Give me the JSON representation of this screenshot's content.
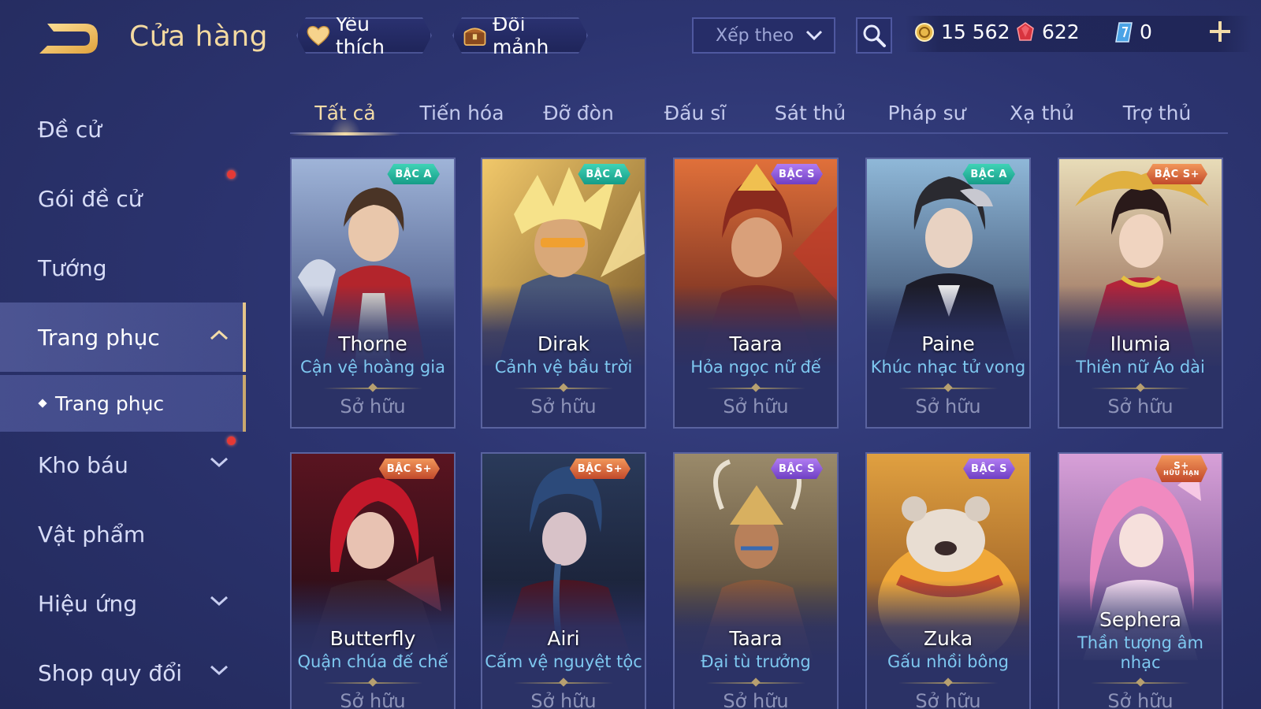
{
  "header": {
    "title": "Cửa hàng",
    "favorite_label": "Yêu thích",
    "fragment_label": "Đổi mảnh",
    "sort_label": "Xếp theo",
    "currency": {
      "gold": "15 562",
      "ruby": "622",
      "voucher": "0"
    }
  },
  "sidebar": {
    "items": [
      {
        "label": "Đề cử"
      },
      {
        "label": "Gói đề cử"
      },
      {
        "label": "Tướng"
      },
      {
        "label": "Trang phục"
      },
      {
        "label": "Kho báu"
      },
      {
        "label": "Vật phẩm"
      },
      {
        "label": "Hiệu ứng"
      },
      {
        "label": "Shop quy đổi"
      }
    ],
    "sub_item": {
      "label": "Trang phục"
    }
  },
  "tabs": [
    {
      "label": "Tất cả"
    },
    {
      "label": "Tiến hóa"
    },
    {
      "label": "Đỡ đòn"
    },
    {
      "label": "Đấu sĩ"
    },
    {
      "label": "Sát thủ"
    },
    {
      "label": "Pháp sư"
    },
    {
      "label": "Xạ thủ"
    },
    {
      "label": "Trợ thủ"
    }
  ],
  "cards": [
    {
      "hero": "Thorne",
      "skin": "Cận vệ hoàng gia",
      "tier": "BẬC A",
      "status": "Sở hữu"
    },
    {
      "hero": "Dirak",
      "skin": "Cảnh vệ bầu trời",
      "tier": "BẬC A",
      "status": "Sở hữu"
    },
    {
      "hero": "Taara",
      "skin": "Hỏa ngọc nữ đế",
      "tier": "BẬC S",
      "status": "Sở hữu"
    },
    {
      "hero": "Paine",
      "skin": "Khúc nhạc tử vong",
      "tier": "BẬC A",
      "status": "Sở hữu"
    },
    {
      "hero": "Ilumia",
      "skin": "Thiên nữ Áo dài",
      "tier": "BẬC S+",
      "status": "Sở hữu"
    },
    {
      "hero": "Butterfly",
      "skin": "Quận chúa đế chế",
      "tier": "BẬC S+",
      "status": "Sở hữu"
    },
    {
      "hero": "Airi",
      "skin": "Cấm vệ nguyệt tộc",
      "tier": "BẬC S+",
      "status": "Sở hữu"
    },
    {
      "hero": "Taara",
      "skin": "Đại tù trưởng",
      "tier": "BẬC S",
      "status": "Sở hữu"
    },
    {
      "hero": "Zuka",
      "skin": "Gấu nhồi bông",
      "tier": "BẬC S",
      "status": "Sở hữu"
    },
    {
      "hero": "Sephera",
      "skin": "Thần tượng âm nhạc",
      "tier": "S+",
      "tier_sub": "HỮU HẠN",
      "status": "Sở hữu"
    }
  ],
  "colors": {
    "background": "#2c3470",
    "accent_gold": "#f3d9a0",
    "skin_name_blue": "#7ec8f0",
    "tier_a": "#169c87",
    "tier_s": "#6f3fc4",
    "tier_s_plus": "#c2492b",
    "notification_red": "#e53935"
  },
  "icons": {
    "back": "back-arrow-icon",
    "favorite": "heart-icon",
    "fragment": "chest-icon",
    "sort": "chevron-down-icon",
    "search": "search-icon",
    "gold": "gold-coin-icon",
    "ruby": "ruby-gem-icon",
    "voucher": "voucher-icon",
    "add": "plus-icon"
  }
}
